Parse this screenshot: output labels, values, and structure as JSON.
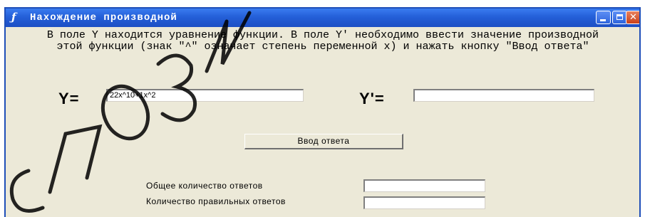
{
  "window": {
    "title": "Нахождение производной",
    "app_icon": "function-icon",
    "controls": {
      "minimize": "minimize-icon",
      "maximize": "maximize-icon",
      "close": "close-icon"
    }
  },
  "instruction": "В поле Y находится уравнение функции. В поле Y' необходимо ввести значение производной этой функции (знак \"^\" означает степень переменной х) и нажать кнопку \"Ввод ответа\"",
  "function_field": {
    "label": "Y=",
    "value": "22x^10+1x^2"
  },
  "derivative_field": {
    "label": "Y'=",
    "value": ""
  },
  "submit_button": {
    "label": "Ввод ответа"
  },
  "stats": {
    "total_label": "Общее количество ответов",
    "total_value": "",
    "correct_label": "Количество правильных ответов",
    "correct_value": ""
  },
  "watermark": {
    "text": "СПОЗИ",
    "color": "#000000"
  }
}
